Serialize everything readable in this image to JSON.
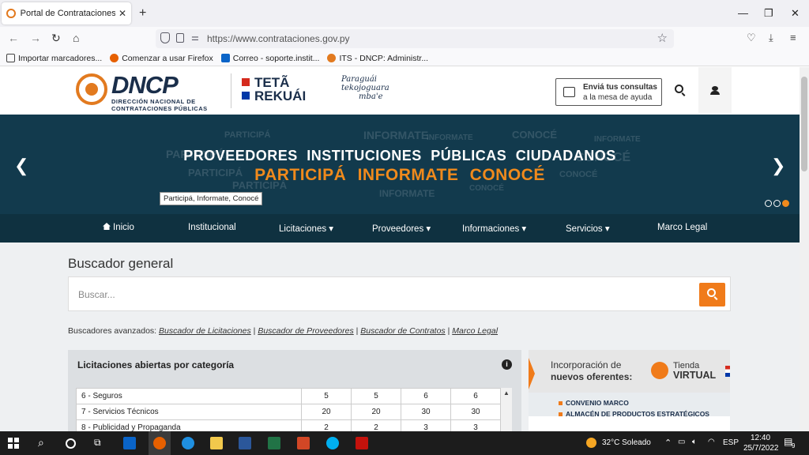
{
  "browser": {
    "tab_title": "Portal de Contrataciones Públic",
    "url": "https://www.contrataciones.gov.py",
    "bookmarks": [
      {
        "label": "Importar marcadores...",
        "icon": "import-icon"
      },
      {
        "label": "Comenzar a usar Firefox",
        "icon": "firefox-icon"
      },
      {
        "label": "Correo - soporte.instit...",
        "icon": "outlook-icon"
      },
      {
        "label": "ITS - DNCP: Administr...",
        "icon": "dncp-icon"
      }
    ]
  },
  "header": {
    "logo_name": "DNCP",
    "logo_sub1": "DIRECCIÓN NACIONAL DE",
    "logo_sub2": "CONTRATACIONES PÚBLICAS",
    "teta1": "TETÃ",
    "teta2": "REKUÁI",
    "paraguai1": "Paraguái",
    "paraguai2": "tekojoguara",
    "paraguai3": "mba'e",
    "help_line1": "Enviá tus consultas",
    "help_line2": "a la mesa de ayuda"
  },
  "banner": {
    "line1": "PROVEEDORES  INSTITUCIONES PÚBLICAS  CIUDADANOS",
    "line2": "PARTICIPÁ  INFORMATE  CONOCÉ",
    "tooltip": "Participá, Informate, Conocé",
    "wordcloud": [
      "PARTICIPÁ",
      "INFORMATE",
      "CONOCÉ",
      "PARTICIPÁ",
      "INFORMATE",
      "CONOCÉ",
      "PARTICIPÁ",
      "CONOCÉ",
      "INFORMATE",
      "PARTICIPÁ",
      "CONOCÉ",
      "INFORMATE"
    ]
  },
  "nav": {
    "items": [
      "Inicio",
      "Institucional",
      "Licitaciones ▾",
      "Proveedores ▾",
      "Informaciones ▾",
      "Servicios ▾",
      "Marco Legal"
    ]
  },
  "search": {
    "title": "Buscador general",
    "placeholder": "Buscar...",
    "advanced_label": "Buscadores avanzados:",
    "links": [
      "Buscador de Licitaciones",
      "Buscador de Proveedores",
      "Buscador de Contratos",
      "Marco Legal"
    ]
  },
  "licitaciones": {
    "title": "Licitaciones abiertas por categoría",
    "rows": [
      {
        "cat": "6 - Seguros",
        "v": [
          "5",
          "5",
          "6",
          "6"
        ]
      },
      {
        "cat": "7 - Servicios Técnicos",
        "v": [
          "20",
          "20",
          "30",
          "30"
        ]
      },
      {
        "cat": "8 - Publicidad y Propaganda",
        "v": [
          "2",
          "2",
          "3",
          "3"
        ]
      }
    ]
  },
  "promo": {
    "line1": "Incorporación de",
    "line2": "nuevos oferentes:",
    "tienda": "Tienda",
    "virtual": "VIRTUAL",
    "bullet1": "CONVENIO MARCO",
    "bullet2": "ALMACÉN DE PRODUCTOS ESTRATÉGICOS"
  },
  "taskbar": {
    "weather": "32°C  Soleado",
    "lang": "ESP",
    "time": "12:40",
    "date": "25/7/2022",
    "notifications": "9"
  }
}
